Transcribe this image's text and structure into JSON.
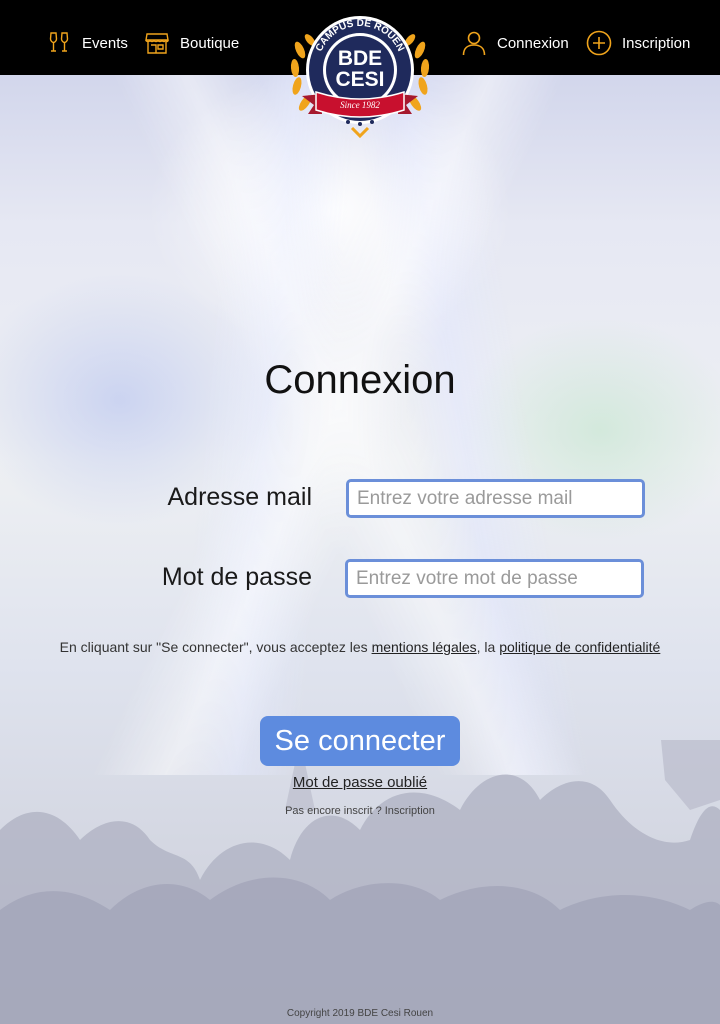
{
  "header": {
    "nav": {
      "events": "Events",
      "boutique": "Boutique",
      "connexion": "Connexion",
      "inscription": "Inscription"
    },
    "logo": {
      "arc_text": "CAMPUS DE ROUEN",
      "main_line1": "BDE",
      "main_line2": "CESI",
      "ribbon_text": "Since 1982"
    }
  },
  "main": {
    "title": "Connexion",
    "email": {
      "label": "Adresse mail",
      "placeholder": "Entrez votre adresse mail",
      "value": ""
    },
    "password": {
      "label": "Mot de passe",
      "placeholder": "Entrez votre mot de passe",
      "value": ""
    },
    "legal": {
      "prefix": "En cliquant sur \"Se connecter\", vous acceptez les ",
      "link_mentions": "mentions légales",
      "separator": ", la ",
      "link_privacy": "politique de confidentialité"
    },
    "submit_label": "Se connecter",
    "forgot_label": "Mot de passe oublié",
    "signup_text": "Pas encore inscrit ? Inscription"
  },
  "footer": {
    "copyright": "Copyright 2019 BDE Cesi Rouen"
  },
  "colors": {
    "header_bg": "#000000",
    "accent_gold": "#f0a41c",
    "button_blue": "#5d8bdf",
    "input_border": "#6b8fd9"
  },
  "icons": {
    "events": "champagne-glasses-icon",
    "boutique": "shop-icon",
    "connexion": "user-icon",
    "inscription": "plus-circle-icon"
  }
}
